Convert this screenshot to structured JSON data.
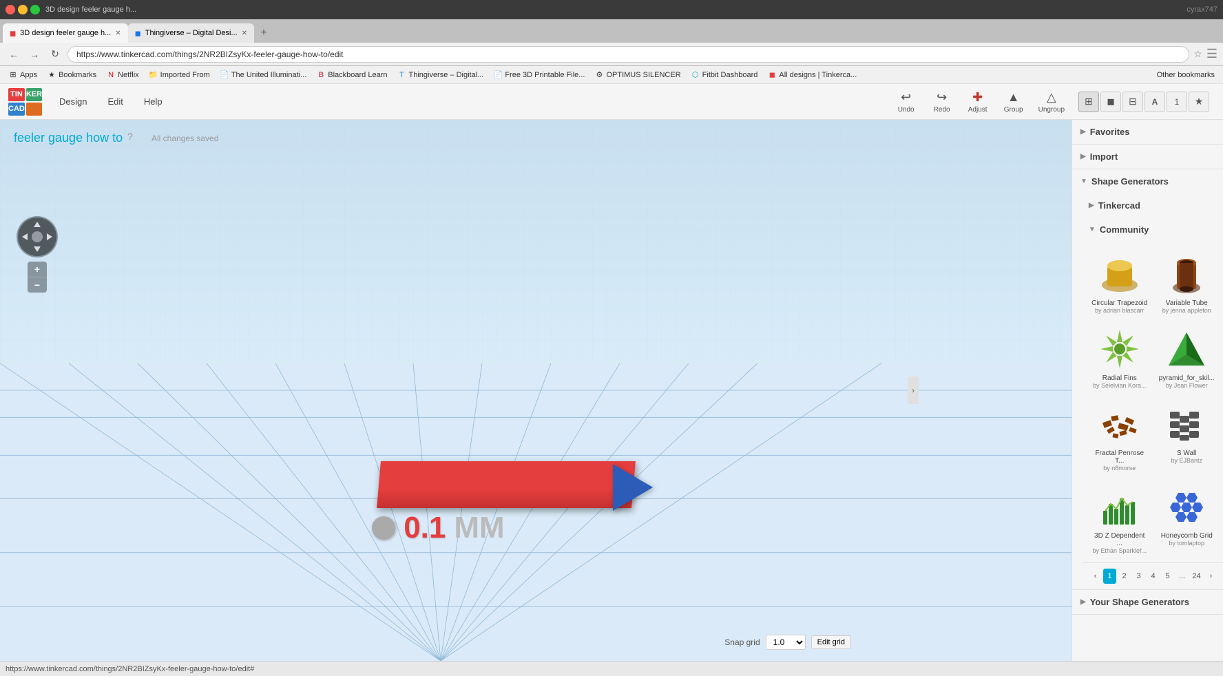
{
  "browser": {
    "title": "3D design feeler gauge h...",
    "title2": "Thingiverse – Digital Desi...",
    "url": "https://www.tinkercad.com/things/2NR2BIZsyKx-feeler-gauge-how-to/edit",
    "status_url": "https://www.tinkercad.com/things/2NR2BIZsyKx-feeler-gauge-how-to/edit#"
  },
  "bookmarks": [
    {
      "id": "apps",
      "label": "Apps"
    },
    {
      "id": "bookmarks-folder",
      "label": "Bookmarks"
    },
    {
      "id": "netflix",
      "label": "Netflix"
    },
    {
      "id": "imported-from",
      "label": "Imported From"
    },
    {
      "id": "illuminati",
      "label": "The United Illuminati..."
    },
    {
      "id": "blackboard",
      "label": "Blackboard Learn"
    },
    {
      "id": "thingiverse",
      "label": "Thingiverse – Digital..."
    },
    {
      "id": "free3d",
      "label": "Free 3D Printable File..."
    },
    {
      "id": "optimus",
      "label": "OPTIMUS SILENCER"
    },
    {
      "id": "fitbit",
      "label": "Fitbit Dashboard"
    },
    {
      "id": "alldesigns",
      "label": "All designs | Tinkerca..."
    },
    {
      "id": "other",
      "label": "Other bookmarks"
    }
  ],
  "tinkercad": {
    "logo": {
      "tin": "TIN",
      "ker": "KER",
      "cad": "CAD"
    },
    "nav": {
      "design": "Design",
      "edit": "Edit",
      "help": "Help"
    },
    "tools": {
      "undo": "Undo",
      "redo": "Redo",
      "adjust": "Adjust",
      "group": "Group",
      "ungroup": "Ungroup"
    },
    "design_title": "feeler gauge how to",
    "autosave": "All changes saved",
    "help_hint": "?"
  },
  "viewport": {
    "snap_grid_label": "Snap grid",
    "snap_value": "1.0",
    "edit_grid_label": "Edit grid",
    "zoom_in": "+",
    "zoom_out": "−"
  },
  "panel": {
    "favorites_label": "Favorites",
    "import_label": "Import",
    "shape_generators_label": "Shape Generators",
    "tinkercad_label": "Tinkercad",
    "community_label": "Community",
    "your_shapes_label": "Your Shape Generators",
    "shapes": [
      {
        "id": "circular-trapezoid",
        "name": "Circular Trapezoid",
        "author": "by adrian blascarr",
        "color": "#d4a017",
        "shape": "cylinder"
      },
      {
        "id": "variable-tube",
        "name": "Variable Tube",
        "author": "by jenna appleton",
        "color": "#8B4513",
        "shape": "cylinder"
      },
      {
        "id": "radial-fins",
        "name": "Radial Fins",
        "author": "by Selelvian Kora...",
        "color": "#7fc241",
        "shape": "fins"
      },
      {
        "id": "pyramid-skill",
        "name": "pyramid_for_skil...",
        "author": "by Jean Flower",
        "color": "#2e8b2e",
        "shape": "triangle"
      },
      {
        "id": "fractal-penrose",
        "name": "Fractal Penrose T...",
        "author": "by n8morse",
        "color": "#8B4000",
        "shape": "fractal"
      },
      {
        "id": "s-wall",
        "name": "S Wall",
        "author": "by EJBantz",
        "color": "#666",
        "shape": "swall"
      },
      {
        "id": "3d-z-dependent",
        "name": "3D Z Dependent ...",
        "author": "by Ethan Sparklef...",
        "color": "#2e8b2e",
        "shape": "zigzag"
      },
      {
        "id": "honeycomb-grid",
        "name": "Honeycomb Grid",
        "author": "by tomlaptop",
        "color": "#1a4fd4",
        "shape": "honeycomb"
      }
    ],
    "pagination": {
      "pages": [
        "1",
        "2",
        "3",
        "4",
        "5",
        "...",
        "24"
      ],
      "active": "1",
      "prev": "‹",
      "next": "›"
    }
  },
  "feeler_gauge": {
    "number": "0.1",
    "unit": "MM"
  }
}
